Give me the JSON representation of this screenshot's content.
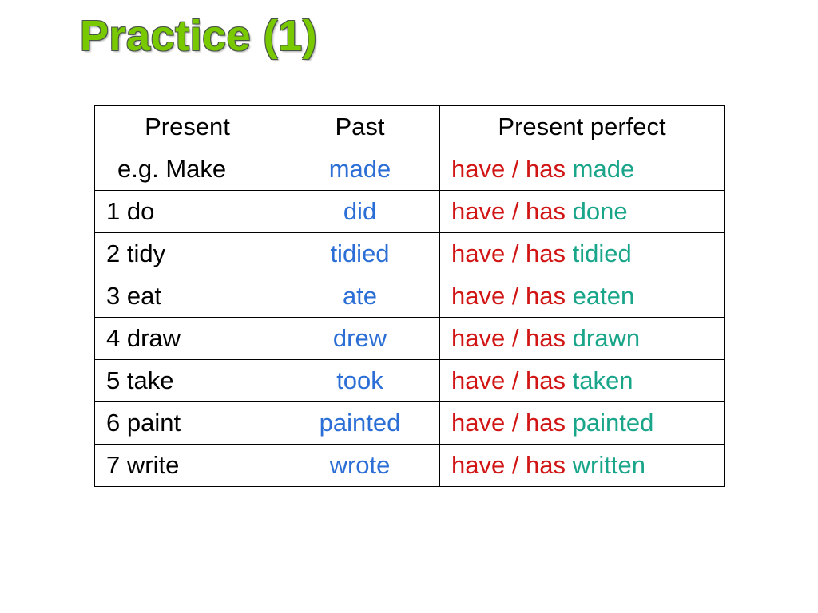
{
  "title": "Practice (1)",
  "headers": {
    "present": "Present",
    "past": "Past",
    "present_perfect": "Present perfect"
  },
  "aux": "have / has ",
  "rows": [
    {
      "present": "e.g. Make",
      "past": "made",
      "participle": "made"
    },
    {
      "present": "1  do",
      "past": "did",
      "participle": "done"
    },
    {
      "present": "2  tidy",
      "past": "tidied",
      "participle": "tidied"
    },
    {
      "present": "3  eat",
      "past": "ate",
      "participle": "eaten"
    },
    {
      "present": "4  draw",
      "past": "drew",
      "participle": "drawn"
    },
    {
      "present": "5  take",
      "past": "took",
      "participle": "taken"
    },
    {
      "present": "6  paint",
      "past": "painted",
      "participle": "painted"
    },
    {
      "present": "7  write",
      "past": "wrote",
      "participle": "written"
    }
  ]
}
